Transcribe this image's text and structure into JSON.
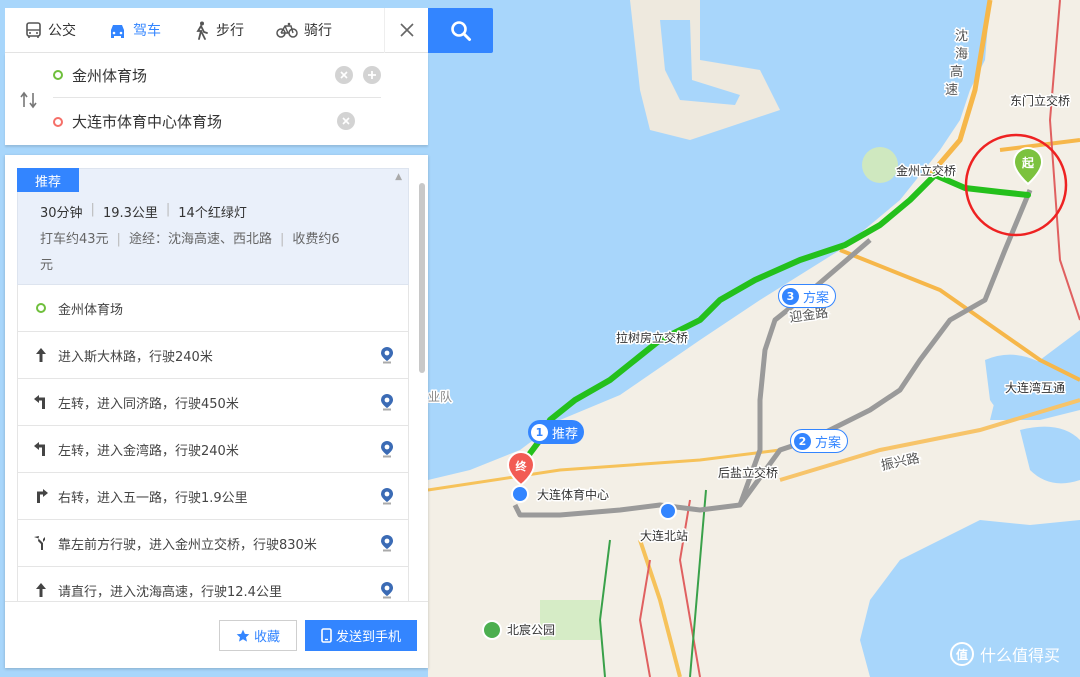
{
  "modes": [
    {
      "label": "公交",
      "icon": "bus-icon"
    },
    {
      "label": "驾车",
      "icon": "car-icon",
      "active": true
    },
    {
      "label": "步行",
      "icon": "walk-icon"
    },
    {
      "label": "骑行",
      "icon": "bike-icon"
    }
  ],
  "search": {
    "start": "金州体育场",
    "end": "大连市体育中心体育场"
  },
  "result": {
    "tag": "推荐",
    "duration": "30分钟",
    "distance": "19.3公里",
    "lights": "14个红绿灯",
    "taxi": "打车约43元",
    "via": "途经：沈海高速、西北路",
    "toll_part1": "收费约6",
    "toll_part2": "元",
    "origin": "金州体育场",
    "steps": [
      {
        "text": "进入斯大林路，行驶240米",
        "icon": "straight-arrow-icon"
      },
      {
        "text": "左转，进入同济路，行驶450米",
        "icon": "turn-left-icon"
      },
      {
        "text": "左转，进入金湾路，行驶240米",
        "icon": "turn-left-icon"
      },
      {
        "text": "右转，进入五一路，行驶1.9公里",
        "icon": "turn-right-icon"
      },
      {
        "text": "靠左前方行驶，进入金州立交桥，行驶830米",
        "icon": "keep-left-icon"
      },
      {
        "text": "请直行，进入沈海高速，行驶12.4公里",
        "icon": "straight-arrow-icon"
      }
    ],
    "fav_label": "收藏",
    "send_label": "发送到手机"
  },
  "map": {
    "labels": {
      "shenhai1": "沈",
      "shenhai2": "海",
      "shenhai3": "高",
      "shenhai4": "速",
      "dongmen": "东门立交桥",
      "jinzhou": "金州立交桥",
      "lashu": "拉树房立交桥",
      "yingjin": "迎金路",
      "dalianwan": "大连湾互通",
      "houyan": "后盐立交桥",
      "zhenxing": "振兴路",
      "sports": "大连体育中心",
      "north_station": "大连北站",
      "beichen": "北宸公园",
      "edge_left": "业队"
    },
    "badges": {
      "primary": {
        "num": "1",
        "label": "推荐"
      },
      "alt2": {
        "num": "2",
        "label": "方案"
      },
      "alt3": {
        "num": "3",
        "label": "方案"
      }
    },
    "start_marker": "起",
    "end_marker": "终"
  },
  "watermark": {
    "logo": "值",
    "text": "什么值得买"
  }
}
